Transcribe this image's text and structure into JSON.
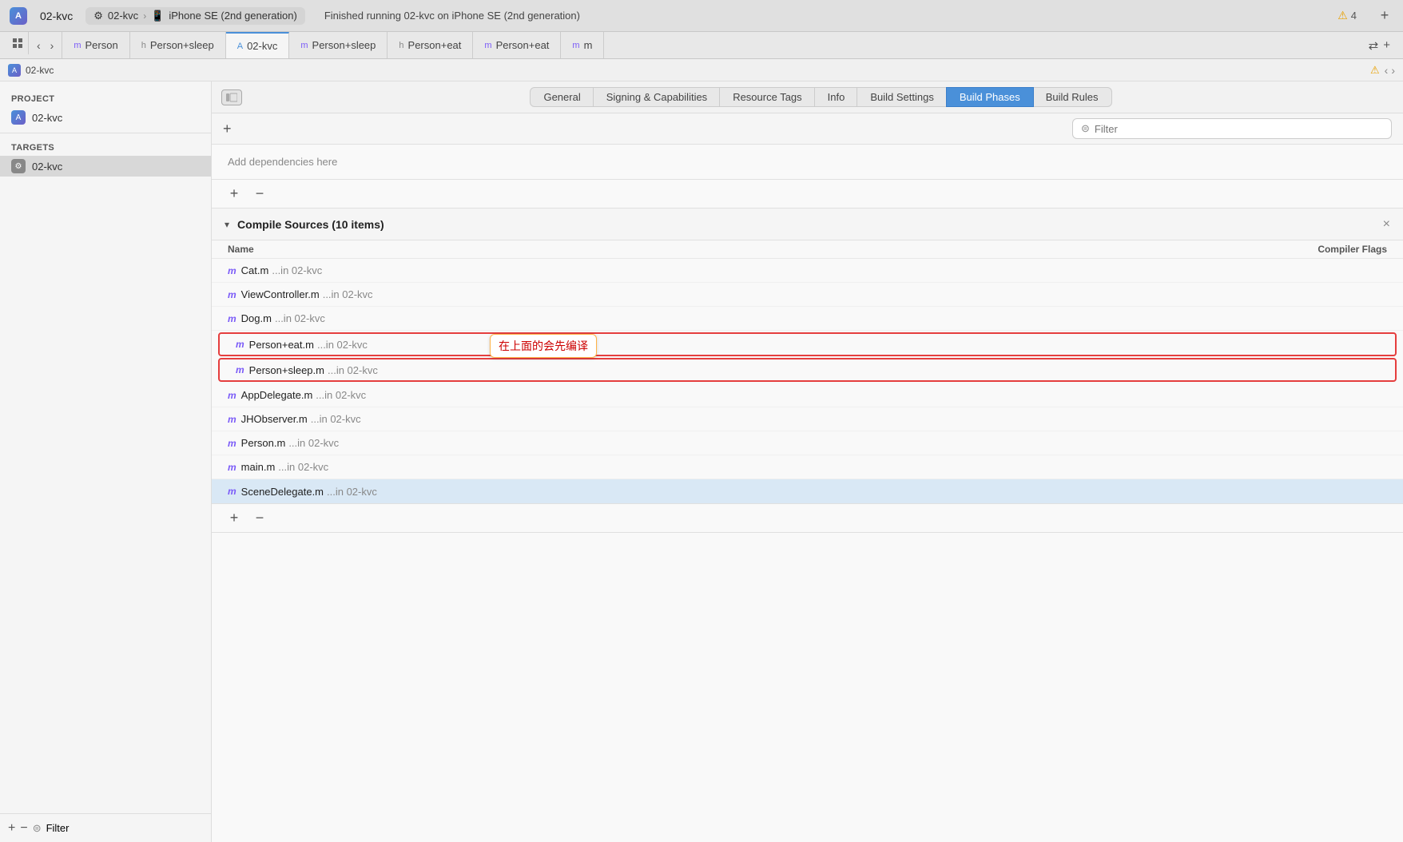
{
  "titleBar": {
    "appName": "02-kvc",
    "breadcrumb": {
      "project": "02-kvc",
      "device": "iPhone SE (2nd generation)"
    },
    "statusText": "Finished running 02-kvc on iPhone SE (2nd generation)",
    "alertCount": "4",
    "plusLabel": "+"
  },
  "tabBar": {
    "tabs": [
      {
        "id": "person",
        "icon": "m",
        "iconType": "purple",
        "label": "Person"
      },
      {
        "id": "person-sleep",
        "icon": "h",
        "iconType": "gray",
        "label": "Person+sleep"
      },
      {
        "id": "02-kvc",
        "icon": "A",
        "iconType": "blue",
        "label": "02-kvc",
        "active": true
      },
      {
        "id": "person-sleep-2",
        "icon": "m",
        "iconType": "purple",
        "label": "Person+sleep"
      },
      {
        "id": "person-eat-h",
        "icon": "h",
        "iconType": "gray",
        "label": "Person+eat"
      },
      {
        "id": "person-eat-m",
        "icon": "m",
        "iconType": "purple",
        "label": "Person+eat"
      },
      {
        "id": "person-m",
        "icon": "m",
        "iconType": "purple",
        "label": "m"
      }
    ]
  },
  "breadcrumbRow": {
    "projectName": "02-kvc"
  },
  "sidebar": {
    "projectLabel": "PROJECT",
    "projectItem": "02-kvc",
    "targetsLabel": "TARGETS",
    "targetItem": "02-kvc",
    "filterPlaceholder": "Filter"
  },
  "settingsTabs": [
    {
      "id": "general",
      "label": "General"
    },
    {
      "id": "signing",
      "label": "Signing & Capabilities"
    },
    {
      "id": "resource",
      "label": "Resource Tags"
    },
    {
      "id": "info",
      "label": "Info"
    },
    {
      "id": "build-settings",
      "label": "Build Settings"
    },
    {
      "id": "build-phases",
      "label": "Build Phases",
      "active": true
    },
    {
      "id": "build-rules",
      "label": "Build Rules"
    }
  ],
  "toolbar": {
    "addLabel": "+",
    "filterPlaceholder": "Filter",
    "filterIconLabel": "⊜"
  },
  "addDepRow": {
    "text": "Add dependencies here"
  },
  "addRemoveRow": {
    "addLabel": "+",
    "removeLabel": "−"
  },
  "compileSection": {
    "title": "Compile Sources (10 items)",
    "chevron": "▾",
    "closeBtn": "×",
    "columnName": "Name",
    "columnFlags": "Compiler Flags",
    "files": [
      {
        "id": "cat",
        "icon": "m",
        "name": "Cat.m",
        "path": "...in 02-kvc",
        "selected": false,
        "boxed": false
      },
      {
        "id": "viewcontroller",
        "icon": "m",
        "name": "ViewController.m",
        "path": "...in 02-kvc",
        "selected": false,
        "boxed": false
      },
      {
        "id": "dog",
        "icon": "m",
        "name": "Dog.m",
        "path": "...in 02-kvc",
        "selected": false,
        "boxed": false
      },
      {
        "id": "person-eat",
        "icon": "m",
        "name": "Person+eat.m",
        "path": "...in 02-kvc",
        "selected": false,
        "boxed": true
      },
      {
        "id": "person-sleep",
        "icon": "m",
        "name": "Person+sleep.m",
        "path": "...in 02-kvc",
        "selected": false,
        "boxed": true
      },
      {
        "id": "appdelegate",
        "icon": "m",
        "name": "AppDelegate.m",
        "path": "...in 02-kvc",
        "selected": false,
        "boxed": false
      },
      {
        "id": "jhobserver",
        "icon": "m",
        "name": "JHObserver.m",
        "path": "...in 02-kvc",
        "selected": false,
        "boxed": false
      },
      {
        "id": "person",
        "icon": "m",
        "name": "Person.m",
        "path": "...in 02-kvc",
        "selected": false,
        "boxed": false
      },
      {
        "id": "main",
        "icon": "m",
        "name": "main.m",
        "path": "...in 02-kvc",
        "selected": false,
        "boxed": false
      },
      {
        "id": "scenedelegate",
        "icon": "m",
        "name": "SceneDelegate.m",
        "path": "...in 02-kvc",
        "selected": true,
        "boxed": false
      }
    ]
  },
  "annotation": {
    "text": "在上面的会先编译"
  }
}
